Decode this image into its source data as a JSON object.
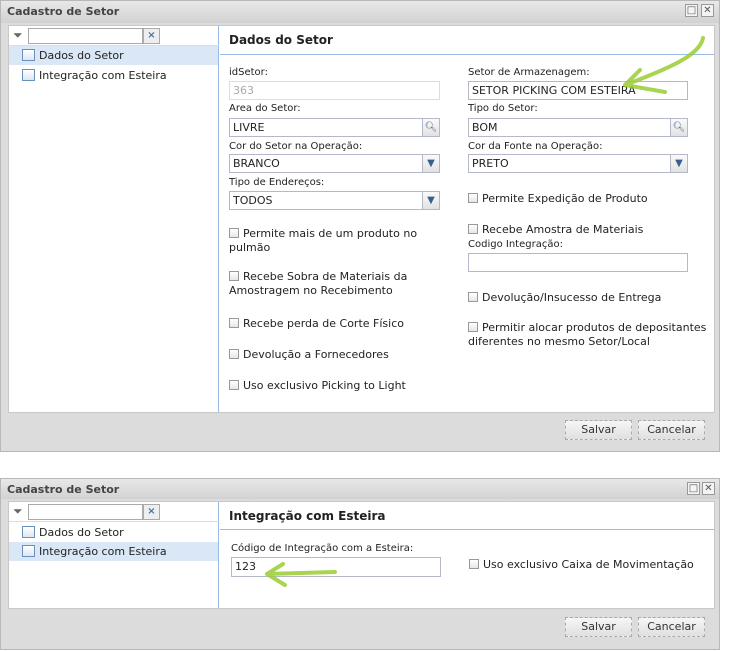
{
  "window1": {
    "title": "Cadastro de Setor",
    "filter": {
      "value": "",
      "clear_icon": "×"
    },
    "nav": [
      {
        "label": "Dados do Setor",
        "selected": true
      },
      {
        "label": "Integração com Esteira",
        "selected": false
      }
    ],
    "section_title": "Dados do Setor",
    "fields": {
      "idSetor": {
        "label": "idSetor:",
        "value": "363"
      },
      "area": {
        "label": "Area do Setor:",
        "value": "LIVRE"
      },
      "cor_setor": {
        "label": "Cor do Setor na Operação:",
        "value": "BRANCO"
      },
      "tipo_enderecos": {
        "label": "Tipo de Endereços:",
        "value": "TODOS"
      },
      "setor_armazenagem": {
        "label": "Setor de Armazenagem:",
        "value": "SETOR PICKING COM ESTEIRA"
      },
      "tipo_setor": {
        "label": "Tipo do Setor:",
        "value": "BOM"
      },
      "cor_fonte": {
        "label": "Cor da Fonte na Operação:",
        "value": "PRETO"
      },
      "codigo_integracao": {
        "label": "Codigo Integração:",
        "value": ""
      }
    },
    "checkboxes_left": [
      {
        "l1": "Permite mais de um produto no",
        "l2": "pulmão",
        "checked": false
      },
      {
        "l1": "Recebe Sobra de Materiais da",
        "l2": "Amostragem no Recebimento",
        "checked": false
      },
      {
        "l1": "Recebe perda de Corte Físico",
        "checked": false
      },
      {
        "l1": "Devolução a Fornecedores",
        "checked": false
      },
      {
        "l1": "Uso exclusivo Picking to Light",
        "checked": false
      }
    ],
    "checkboxes_right": [
      {
        "l1": "Permite Expedição de Produto",
        "checked": false
      },
      {
        "l1": "Recebe Amostra de Materiais",
        "checked": false
      },
      {
        "l1": "Devolução/Insucesso de Entrega",
        "checked": false
      },
      {
        "l1": "Permitir alocar produtos de depositantes",
        "l2": "diferentes no mesmo Setor/Local",
        "checked": false
      }
    ],
    "save": "Salvar",
    "cancel": "Cancelar"
  },
  "window2": {
    "title": "Cadastro de Setor",
    "nav": [
      {
        "label": "Dados do Setor",
        "selected": false
      },
      {
        "label": "Integração com Esteira",
        "selected": true
      }
    ],
    "section_title": "Integração com Esteira",
    "codigo": {
      "label": "Código de Integração com a Esteira:",
      "value": "123"
    },
    "checkbox": {
      "label": "Uso exclusivo Caixa de Movimentação",
      "checked": false
    },
    "save": "Salvar",
    "cancel": "Cancelar"
  },
  "annotation_color": "#9acd32"
}
